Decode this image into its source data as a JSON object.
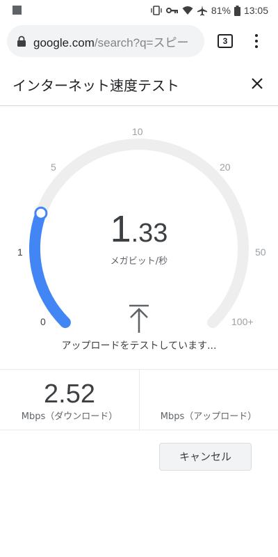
{
  "status_bar": {
    "battery_percent": "81%",
    "time": "13:05"
  },
  "browser": {
    "url_host": "google.com",
    "url_path": "/search?q=スピー",
    "tab_count": "3"
  },
  "panel": {
    "title": "インターネット速度テスト"
  },
  "gauge": {
    "scale_labels": [
      "0",
      "1",
      "5",
      "10",
      "20",
      "50",
      "100+"
    ],
    "current_speed_int": "1",
    "current_speed_dec": ".33",
    "unit": "メガビット/秒",
    "status": "アップロードをテストしています...",
    "progress_fraction": 0.24
  },
  "results": {
    "download_value": "2.52",
    "download_label": "Mbps（ダウンロード）",
    "upload_value": "",
    "upload_label": "Mbps（アップロード）"
  },
  "actions": {
    "cancel_label": "キャンセル"
  },
  "colors": {
    "accent": "#4285f4",
    "track": "#eeeeee"
  },
  "icons": {
    "lock": "lock-icon",
    "close": "close-icon",
    "upload": "upload-arrow-icon",
    "menu": "more-vert-icon"
  }
}
